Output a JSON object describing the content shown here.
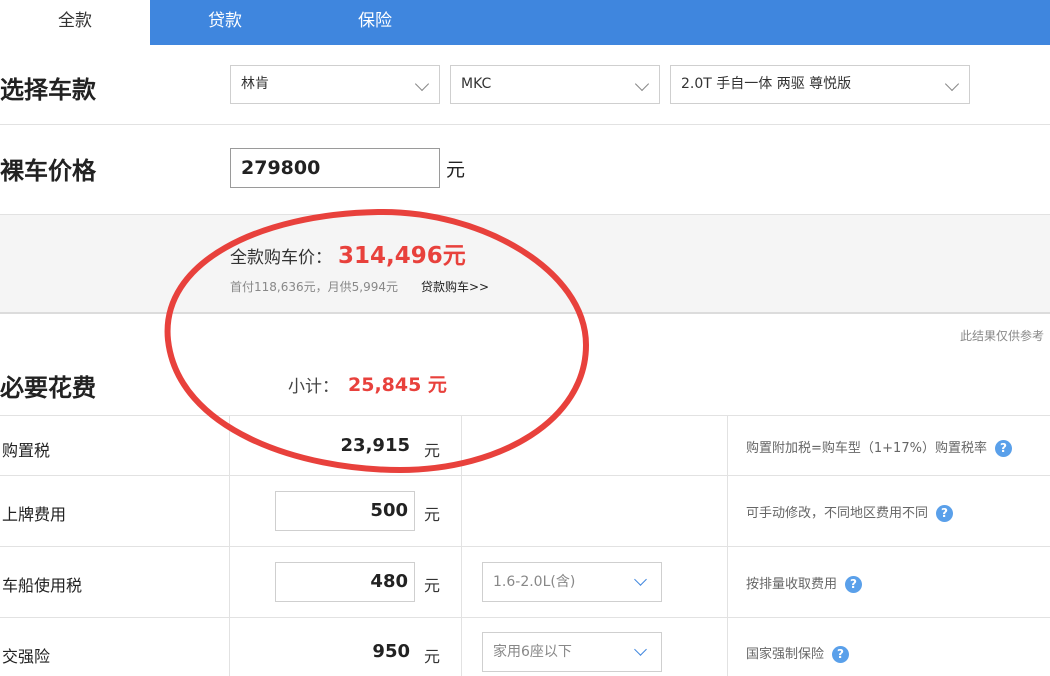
{
  "tabs": [
    {
      "label": "全款",
      "active": true
    },
    {
      "label": "贷款",
      "active": false
    },
    {
      "label": "保险",
      "active": false
    }
  ],
  "select_section": {
    "title": "选择车款",
    "brand": "林肯",
    "model": "MKC",
    "trim": "2.0T 手自一体 两驱 尊悦版"
  },
  "price_section": {
    "title": "裸车价格",
    "value": "279800",
    "unit": "元"
  },
  "summary": {
    "total_label": "全款购车价：",
    "total_value": "314,496元",
    "sub_text": "首付118,636元，月供5,994元",
    "loan_link": "贷款购车>>"
  },
  "disclaimer": "此结果仅供参考",
  "necessary": {
    "title": "必要花费",
    "subtotal_label": "小计：",
    "subtotal_value": "25,845 元"
  },
  "rows": [
    {
      "label": "购置税",
      "amount": "23,915",
      "unit": "元",
      "note": "购置附加税=购车型（1+17%）购置税率"
    },
    {
      "label": "上牌费用",
      "amount": "500",
      "unit": "元",
      "note": "可手动修改，不同地区费用不同"
    },
    {
      "label": "车船使用税",
      "amount": "480",
      "unit": "元",
      "option": "1.6-2.0L(含)",
      "note": "按排量收取费用"
    },
    {
      "label": "交强险",
      "amount": "950",
      "unit": "元",
      "option": "家用6座以下",
      "note": "国家强制保险"
    }
  ],
  "help_glyph": "?",
  "colors": {
    "tab_bar": "#3f86de",
    "price_red": "#e8413c",
    "annotation_circle": "#e8413c"
  }
}
